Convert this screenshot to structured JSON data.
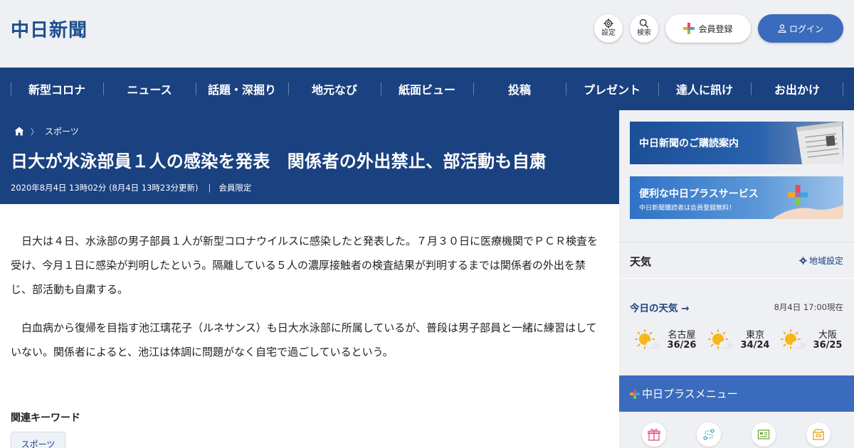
{
  "header": {
    "logo": "中日新聞",
    "settings_label": "設定",
    "search_label": "検索",
    "register_label": "会員登録",
    "login_label": "ログイン"
  },
  "nav": {
    "items": [
      {
        "label": "新型コロナ"
      },
      {
        "label": "ニュース"
      },
      {
        "label": "話題・深掘り"
      },
      {
        "label": "地元なび"
      },
      {
        "label": "紙面ビュー"
      },
      {
        "label": "投稿"
      },
      {
        "label": "プレゼント"
      },
      {
        "label": "達人に訊け"
      },
      {
        "label": "お出かけ"
      }
    ]
  },
  "breadcrumb": {
    "home_icon": "home-icon",
    "category": "スポーツ"
  },
  "article": {
    "headline": "日大が水泳部員１人の感染を発表　関係者の外出禁止、部活動も自粛",
    "published": "2020年8月4日 13時02分 (8月4日 13時23分更新)",
    "separator": "|",
    "access": "会員限定",
    "paragraphs": [
      "　日大は４日、水泳部の男子部員１人が新型コロナウイルスに感染したと発表した。７月３０日に医療機関でＰＣＲ検査を受け、今月１日に感染が判明したという。隔離している５人の濃厚接触者の検査結果が判明するまでは関係者の外出を禁じ、部活動も自粛する。",
      "　白血病から復帰を目指す池江璃花子（ルネサンス）も日大水泳部に所属しているが、普段は男子部員と一緒に練習はしていない。関係者によると、池江は体調に問題がなく自宅で過ごしているという。"
    ],
    "keywords_title": "関連キーワード",
    "keywords": [
      {
        "label": "スポーツ"
      }
    ]
  },
  "sidebar": {
    "banner_subscribe": "中日新聞のご購読案内",
    "banner_plus": "便利な中日プラスサービス",
    "banner_plus_sub": "中日新聞購読者は会員登録無料！",
    "weather_title": "天気",
    "region_setting": "地域設定",
    "today_weather": "今日の天気 →",
    "updated": "8月4日 17:00現在",
    "cities": [
      {
        "name": "名古屋",
        "temp": "36/26",
        "icon": "sun-cloud-icon"
      },
      {
        "name": "東京",
        "temp": "34/24",
        "icon": "sun-cloud-icon"
      },
      {
        "name": "大阪",
        "temp": "36/25",
        "icon": "sun-cloud-icon"
      }
    ],
    "plus_menu_title": "中日プラスメニュー",
    "menu_icons": [
      "gift-icon",
      "route-icon",
      "map-icon",
      "box-icon"
    ]
  },
  "colors": {
    "brand_navy": "#1a4180",
    "brand_blue": "#3a6bbd",
    "background_gray": "#eff0f3"
  }
}
